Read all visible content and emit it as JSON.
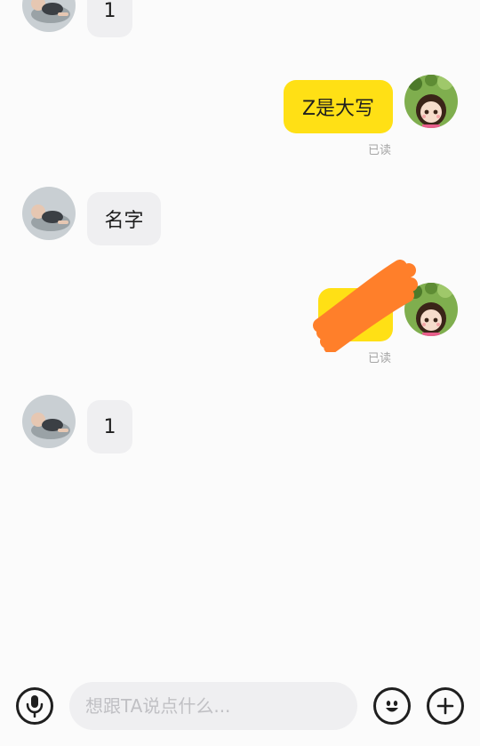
{
  "messages": [
    {
      "side": "incoming",
      "text": "1"
    },
    {
      "side": "outgoing",
      "text": "Z是大写",
      "status": "已读"
    },
    {
      "side": "incoming",
      "text": "名字"
    },
    {
      "side": "outgoing",
      "text": "",
      "status": "已读",
      "redacted": true
    },
    {
      "side": "incoming",
      "text": "1"
    }
  ],
  "composer": {
    "placeholder": "想跟TA说点什么..."
  },
  "icons": {
    "voice": "microphone-icon",
    "emoji": "smiley-icon",
    "more": "plus-icon"
  },
  "colors": {
    "outgoing_bubble": "#ffe015",
    "incoming_bubble": "#efeff1",
    "redaction": "#ff7f2a",
    "background": "#fbfbfb"
  }
}
